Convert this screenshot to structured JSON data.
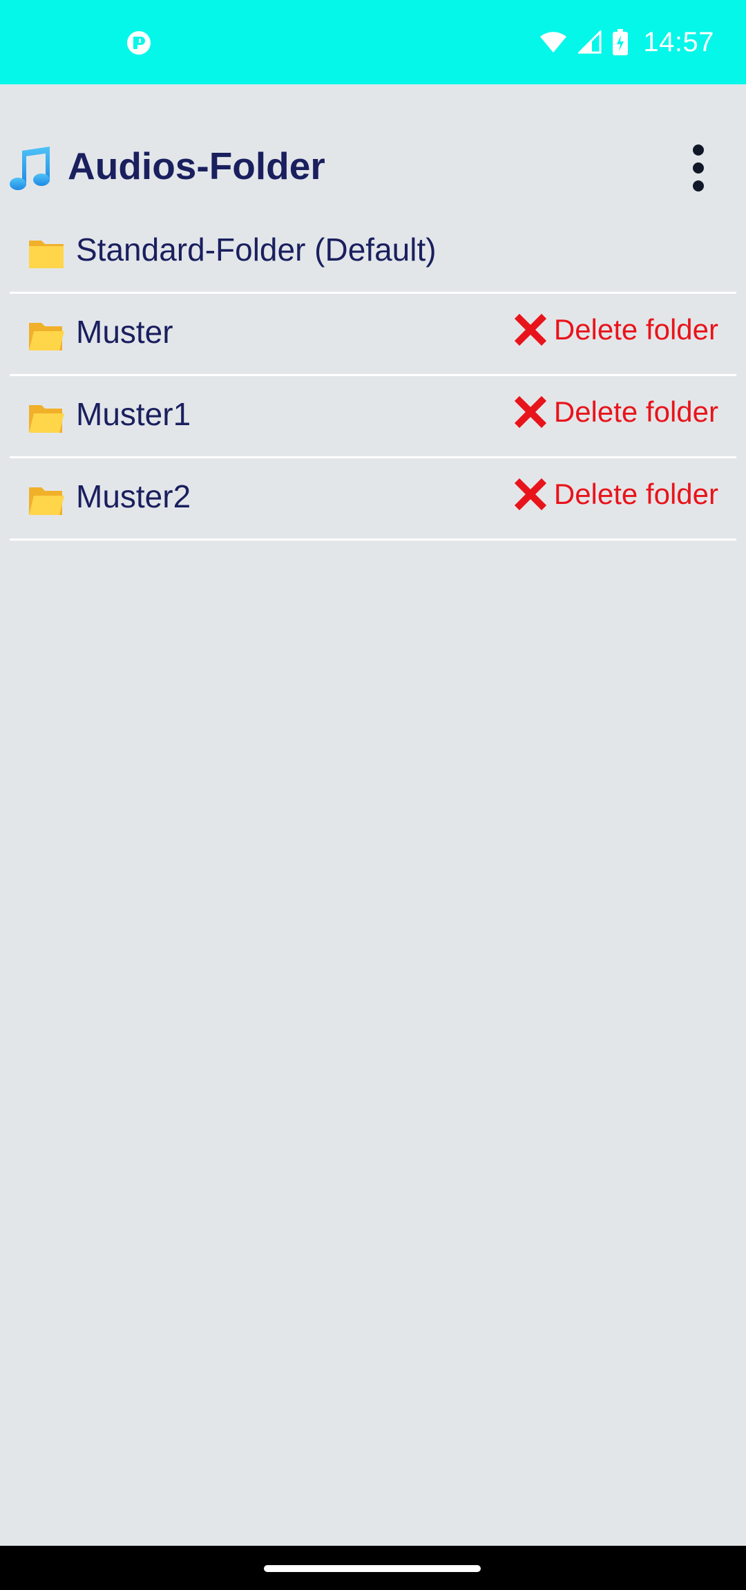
{
  "status_bar": {
    "time": "14:57",
    "background": "#05f7ea",
    "icons": [
      "app-notification-icon",
      "wifi-icon",
      "signal-icon",
      "battery-icon"
    ]
  },
  "header": {
    "title": "Audios-Folder",
    "icon": "music-note-icon",
    "menu_icon": "more-vert-icon"
  },
  "folders": [
    {
      "name": "Standard-Folder (Default)",
      "icon": "folder-closed-icon",
      "deletable": false
    },
    {
      "name": "Muster",
      "icon": "folder-open-icon",
      "deletable": true,
      "delete_label": "Delete folder"
    },
    {
      "name": "Muster1",
      "icon": "folder-open-icon",
      "deletable": true,
      "delete_label": "Delete folder"
    },
    {
      "name": "Muster2",
      "icon": "folder-open-icon",
      "deletable": true,
      "delete_label": "Delete folder"
    }
  ],
  "colors": {
    "text": "#1a1f5e",
    "delete": "#e8141b",
    "background": "#e3e6e9"
  }
}
